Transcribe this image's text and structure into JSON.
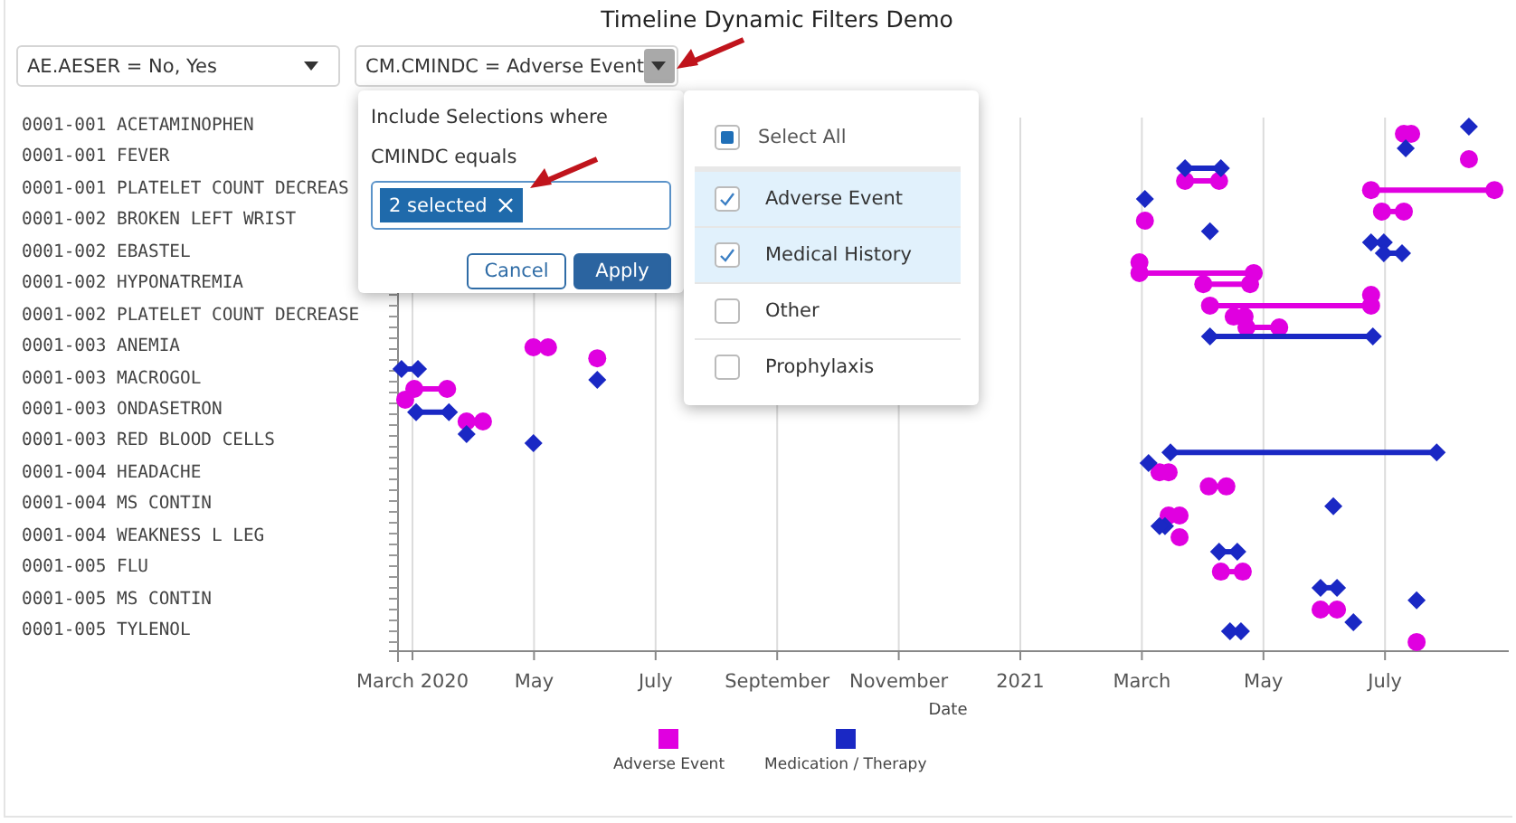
{
  "title": "Timeline Dynamic Filters Demo",
  "filters": [
    {
      "label": "AE.AESER = No, Yes",
      "open": false
    },
    {
      "label": "CM.CMINDC = Adverse Event",
      "open": true
    }
  ],
  "filter_popup": {
    "heading": "Include Selections where",
    "subheading": "CMINDC equals",
    "chip": "2 selected",
    "buttons": [
      {
        "label": "Cancel",
        "kind": "secondary"
      },
      {
        "label": "Apply",
        "kind": "primary"
      }
    ]
  },
  "option_list": {
    "select_all": {
      "label": "Select All",
      "checked": false,
      "indeterminate": true
    },
    "options": [
      {
        "label": "Adverse Event",
        "checked": true
      },
      {
        "label": "Medical History",
        "checked": true
      },
      {
        "label": "Other",
        "checked": false
      },
      {
        "label": "Prophylaxis",
        "checked": false
      }
    ]
  },
  "timeline": {
    "row_labels": [
      "0001-001 ACETAMINOPHEN",
      "0001-001 FEVER",
      "0001-001 PLATELET COUNT DECREAS",
      "0001-002 BROKEN LEFT WRIST",
      "0001-002 EBASTEL",
      "0001-002 HYPONATREMIA",
      "0001-002 PLATELET COUNT DECREASE",
      "0001-003 ANEMIA",
      "0001-003 MACROGOL",
      "0001-003 ONDASETRON",
      "0001-003 RED BLOOD CELLS",
      "0001-004 HEADACHE",
      "0001-004 MS CONTIN",
      "0001-004 WEAKNESS L LEG",
      "0001-005 FLU",
      "0001-005 MS CONTIN",
      "0001-005 TYLENOL"
    ],
    "date_labels": [
      "March 2020",
      "May",
      "July",
      "September",
      "November",
      "2021",
      "March",
      "May",
      "July"
    ],
    "axis_title": "Date",
    "legend": [
      {
        "name": "Adverse Event",
        "color": "#e000e0"
      },
      {
        "name": "Medication / Therapy",
        "color": "#1a28c4"
      }
    ]
  }
}
